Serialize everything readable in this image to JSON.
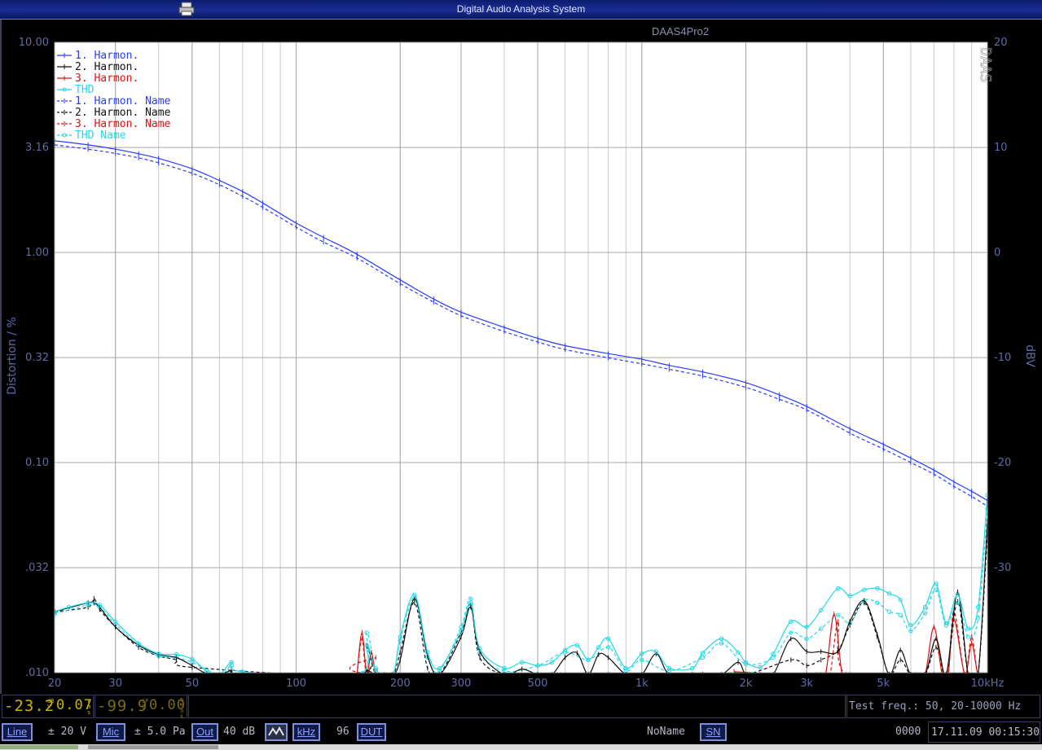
{
  "window": {
    "title": "Digital Audio Analysis System"
  },
  "chart_data": {
    "type": "line",
    "title": "DAAS4Pro2",
    "watermark": "DAAS",
    "xlabel": "",
    "ylabel": "Distortion / %",
    "y2label": "dBV",
    "x_scale": "log",
    "y_scale": "log",
    "xlim": [
      20,
      10000
    ],
    "ylim": [
      0.01,
      10
    ],
    "y2lim": [
      -40,
      20
    ],
    "x_ticks": [
      {
        "v": 20,
        "label": "20"
      },
      {
        "v": 30,
        "label": "30"
      },
      {
        "v": 50,
        "label": "50"
      },
      {
        "v": 100,
        "label": "100"
      },
      {
        "v": 200,
        "label": "200"
      },
      {
        "v": 300,
        "label": "300"
      },
      {
        "v": 500,
        "label": "500"
      },
      {
        "v": 1000,
        "label": "1k"
      },
      {
        "v": 2000,
        "label": "2k"
      },
      {
        "v": 3000,
        "label": "3k"
      },
      {
        "v": 5000,
        "label": "5k"
      },
      {
        "v": 10000,
        "label": "10kHz"
      }
    ],
    "y_ticks": [
      {
        "v": 10,
        "label": "10.00"
      },
      {
        "v": 3.16,
        "label": "3.16"
      },
      {
        "v": 1,
        "label": "1.00"
      },
      {
        "v": 0.316,
        "label": "0.32"
      },
      {
        "v": 0.1,
        "label": "0.10"
      },
      {
        "v": 0.0316,
        "label": ".032"
      },
      {
        "v": 0.01,
        "label": ".010"
      }
    ],
    "y2_ticks": [
      {
        "v": 20,
        "label": "20"
      },
      {
        "v": 10,
        "label": "10"
      },
      {
        "v": 0,
        "label": "0"
      },
      {
        "v": -10,
        "label": "-10"
      },
      {
        "v": -20,
        "label": "-20"
      },
      {
        "v": -30,
        "label": "-30"
      }
    ],
    "grid": true,
    "legend_position": "top-left",
    "series": [
      {
        "name": "1. Harmon.",
        "color": "#2a3cff",
        "dash": false,
        "x": [
          20,
          25,
          30,
          35,
          40,
          50,
          60,
          70,
          80,
          100,
          120,
          150,
          200,
          250,
          300,
          400,
          500,
          600,
          800,
          1000,
          1200,
          1500,
          2000,
          2500,
          3000,
          4000,
          5000,
          6000,
          7000,
          8000,
          9000,
          10000
        ],
        "y": [
          3.4,
          3.25,
          3.1,
          2.95,
          2.8,
          2.5,
          2.2,
          1.95,
          1.72,
          1.38,
          1.18,
          0.98,
          0.74,
          0.6,
          0.52,
          0.44,
          0.39,
          0.36,
          0.33,
          0.31,
          0.29,
          0.27,
          0.24,
          0.21,
          0.185,
          0.145,
          0.122,
          0.105,
          0.092,
          0.081,
          0.073,
          0.066
        ]
      },
      {
        "name": "2. Harmon.",
        "color": "#111111",
        "dash": false,
        "x": [
          20,
          25,
          26,
          27,
          30,
          35,
          40,
          45,
          50,
          55,
          60,
          65,
          70,
          150,
          160,
          170,
          190,
          200,
          220,
          240,
          260,
          300,
          320,
          340,
          400,
          450,
          500,
          550,
          600,
          650,
          700,
          750,
          800,
          900,
          1000,
          1100,
          1200,
          1400,
          1500,
          1700,
          1900,
          2000,
          2200,
          2400,
          2700,
          3000,
          3300,
          3700,
          4000,
          4400,
          4800,
          5200,
          5600,
          6000,
          6600,
          7100,
          7600,
          8200,
          8800,
          9400,
          10000
        ],
        "y": [
          0.0195,
          0.0215,
          0.0215,
          0.0205,
          0.0165,
          0.0135,
          0.0122,
          0.0118,
          0.0108,
          0.0099,
          0.0098,
          0.0102,
          0.0098,
          0.0095,
          0.0103,
          0.0098,
          0.0095,
          0.0115,
          0.0225,
          0.012,
          0.0098,
          0.0148,
          0.0205,
          0.0126,
          0.0098,
          0.0104,
          0.0098,
          0.0098,
          0.0118,
          0.0124,
          0.0098,
          0.0122,
          0.0118,
          0.0098,
          0.0098,
          0.0123,
          0.0098,
          0.0098,
          0.0098,
          0.0098,
          0.0112,
          0.0098,
          0.0098,
          0.0098,
          0.0145,
          0.0126,
          0.0126,
          0.0126,
          0.0175,
          0.022,
          0.0152,
          0.0098,
          0.0128,
          0.0098,
          0.0098,
          0.0145,
          0.0098,
          0.0242,
          0.0098,
          0.0098,
          0.052
        ]
      },
      {
        "name": "3. Harmon.",
        "color": "#dd1111",
        "dash": false,
        "x": [
          150,
          155,
          160,
          165,
          170,
          180,
          1800,
          1850,
          1900,
          1950,
          3000,
          3200,
          3400,
          3600,
          3800,
          4000,
          6000,
          6200,
          6600,
          7000,
          7400,
          7700,
          8000,
          8600,
          9000,
          9400,
          10000
        ],
        "y": [
          0.0098,
          0.0155,
          0.0098,
          0.0125,
          0.0098,
          0.0098,
          0.0098,
          0.0101,
          0.0098,
          0.0098,
          0.0098,
          0.0098,
          0.0098,
          0.019,
          0.0098,
          0.0098,
          0.0098,
          0.0098,
          0.0098,
          0.0165,
          0.0098,
          0.0098,
          0.018,
          0.0098,
          0.0138,
          0.0098,
          0.0098
        ]
      },
      {
        "name": "THD",
        "color": "#22d8e8",
        "dash": false,
        "x": [
          20,
          22,
          25,
          27,
          30,
          35,
          40,
          45,
          50,
          55,
          60,
          65,
          70,
          150,
          160,
          170,
          190,
          200,
          220,
          240,
          260,
          300,
          320,
          340,
          400,
          450,
          500,
          550,
          600,
          650,
          700,
          750,
          800,
          900,
          1000,
          1100,
          1200,
          1400,
          1500,
          1700,
          1900,
          2000,
          2200,
          2400,
          2700,
          3000,
          3300,
          3700,
          4000,
          4400,
          4800,
          5200,
          5600,
          6000,
          6600,
          7100,
          7600,
          8200,
          8800,
          9400,
          10000
        ],
        "y": [
          0.0195,
          0.0205,
          0.0215,
          0.021,
          0.0175,
          0.0138,
          0.0123,
          0.0122,
          0.0116,
          0.0102,
          0.0098,
          0.0112,
          0.0101,
          0.0098,
          0.0135,
          0.0103,
          0.0098,
          0.0148,
          0.0235,
          0.0125,
          0.0105,
          0.0158,
          0.0215,
          0.013,
          0.0105,
          0.0112,
          0.0108,
          0.0112,
          0.0128,
          0.0135,
          0.0115,
          0.0132,
          0.0145,
          0.0105,
          0.0123,
          0.0126,
          0.0105,
          0.0105,
          0.0124,
          0.0145,
          0.0125,
          0.0112,
          0.0106,
          0.0123,
          0.0175,
          0.0165,
          0.0198,
          0.0252,
          0.0232,
          0.0248,
          0.0252,
          0.0238,
          0.0222,
          0.0168,
          0.0205,
          0.0265,
          0.0172,
          0.0235,
          0.0162,
          0.0205,
          0.07
        ]
      },
      {
        "name": "1. Harmon. Name",
        "color": "#2a3cff",
        "dash": true,
        "x": [
          20,
          25,
          30,
          35,
          40,
          50,
          60,
          70,
          80,
          100,
          120,
          150,
          200,
          250,
          300,
          400,
          500,
          600,
          800,
          1000,
          1200,
          1500,
          2000,
          2500,
          3000,
          4000,
          5000,
          6000,
          7000,
          8000,
          9000,
          10000
        ],
        "y": [
          3.25,
          3.1,
          2.96,
          2.82,
          2.67,
          2.38,
          2.1,
          1.85,
          1.64,
          1.32,
          1.12,
          0.94,
          0.71,
          0.58,
          0.5,
          0.42,
          0.375,
          0.345,
          0.315,
          0.295,
          0.278,
          0.258,
          0.228,
          0.2,
          0.178,
          0.138,
          0.116,
          0.1,
          0.088,
          0.077,
          0.069,
          0.062
        ]
      },
      {
        "name": "2. Harmon. Name",
        "color": "#111111",
        "dash": true,
        "x": [
          20,
          25,
          26,
          27,
          30,
          35,
          40,
          45,
          50,
          150,
          160,
          170,
          190,
          200,
          220,
          240,
          260,
          300,
          320,
          340,
          400,
          500,
          700,
          800,
          900,
          1000,
          1500,
          2000,
          2700,
          3000,
          3300,
          3700,
          4000,
          4400,
          4800,
          5200,
          5600,
          6000,
          6600,
          7100,
          7600,
          8200,
          8800,
          9400,
          10000
        ],
        "y": [
          0.0195,
          0.0205,
          0.0225,
          0.02,
          0.0165,
          0.0132,
          0.012,
          0.0115,
          0.0106,
          0.0098,
          0.0135,
          0.0098,
          0.0098,
          0.0125,
          0.0215,
          0.0105,
          0.0098,
          0.0155,
          0.021,
          0.0118,
          0.0098,
          0.0098,
          0.0098,
          0.0098,
          0.0098,
          0.0098,
          0.0098,
          0.0098,
          0.0115,
          0.0108,
          0.0115,
          0.0128,
          0.0168,
          0.0215,
          0.0148,
          0.0098,
          0.0115,
          0.0098,
          0.0098,
          0.0132,
          0.0098,
          0.0218,
          0.0098,
          0.0098,
          0.0465
        ]
      },
      {
        "name": "3. Harmon. Name",
        "color": "#dd1111",
        "dash": true,
        "x": [
          150,
          155,
          160,
          170,
          180,
          3300,
          3500,
          3700,
          3900,
          6600,
          7000,
          7400,
          7700,
          8000,
          8600,
          9000,
          9400,
          10000
        ],
        "y": [
          0.0098,
          0.0145,
          0.0098,
          0.0118,
          0.0098,
          0.0098,
          0.0098,
          0.0175,
          0.0098,
          0.0098,
          0.0098,
          0.0098,
          0.0098,
          0.0195,
          0.0098,
          0.0148,
          0.0098,
          0.0098
        ]
      },
      {
        "name": "THD Name",
        "color": "#22d8e8",
        "dash": true,
        "x": [
          20,
          25,
          27,
          30,
          35,
          40,
          45,
          50,
          60,
          65,
          70,
          150,
          160,
          170,
          190,
          200,
          220,
          240,
          260,
          300,
          320,
          340,
          400,
          500,
          600,
          700,
          800,
          900,
          1000,
          1200,
          1500,
          1700,
          2000,
          2400,
          2700,
          3000,
          3300,
          3700,
          4000,
          4400,
          4800,
          5200,
          5600,
          6000,
          6600,
          7100,
          7600,
          8200,
          8800,
          9400,
          10000
        ],
        "y": [
          0.019,
          0.021,
          0.0205,
          0.017,
          0.0135,
          0.012,
          0.0118,
          0.0112,
          0.0098,
          0.0108,
          0.0098,
          0.0098,
          0.0155,
          0.0105,
          0.0098,
          0.0142,
          0.0225,
          0.0118,
          0.0102,
          0.0165,
          0.0225,
          0.0125,
          0.0102,
          0.0108,
          0.0125,
          0.0115,
          0.0132,
          0.0102,
          0.0115,
          0.0102,
          0.0118,
          0.0138,
          0.011,
          0.0118,
          0.0155,
          0.0145,
          0.0162,
          0.0188,
          0.0172,
          0.022,
          0.0215,
          0.0195,
          0.0188,
          0.0158,
          0.0192,
          0.0248,
          0.0168,
          0.0215,
          0.0148,
          0.0182,
          0.06
        ]
      }
    ]
  },
  "statusbar": {
    "meter1": "-23.2",
    "meter1_unit": "dBV",
    "meter1b": "0.07",
    "meter1b_unit": "rms",
    "meter2": "-99.9",
    "meter2_unit": "SPL",
    "meter2b": "0.00",
    "meter2b_unit": "peak",
    "test_freq": "Test freq.: 50, 20-10000 Hz",
    "line_label": "Line",
    "line_value": "± 20 V",
    "mic_label": "Mic",
    "mic_value": "± 5.0 Pa",
    "out_label": "Out",
    "out_value": "40 dB",
    "khz_label": "kHz",
    "khz_value": "96",
    "dut_label": "DUT",
    "dut_name": "NoName",
    "sn_label": "SN",
    "sn_value": "0000",
    "datetime": "17.11.09 00:15:30"
  }
}
